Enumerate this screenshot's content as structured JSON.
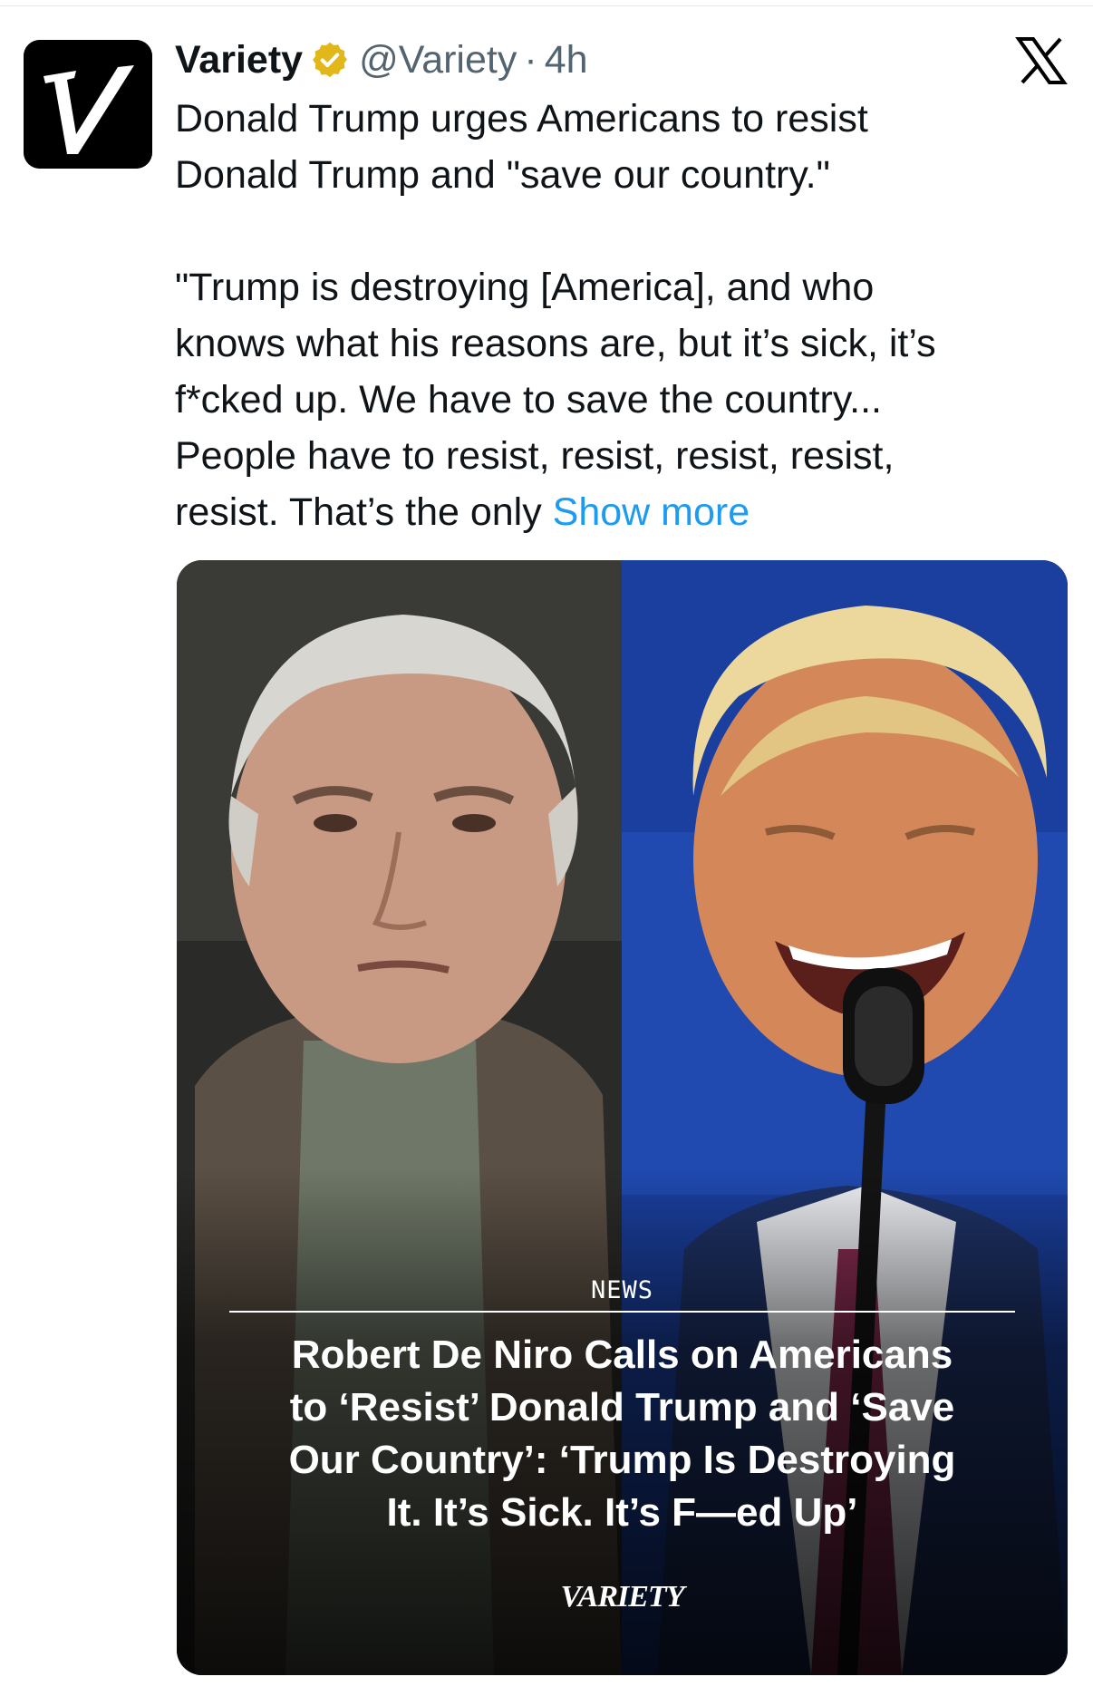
{
  "tweet": {
    "author": {
      "name": "Variety",
      "handle": "@Variety",
      "separator": "·",
      "time": "4h",
      "verified_color": "#e2b719",
      "avatar_icon": "variety-v-logo-icon"
    },
    "platform_icon": "x-logo-icon",
    "lines": {
      "line1": "Donald Trump urges Americans to resist",
      "line2": "Donald Trump and \"save our country.\"",
      "line3": "\"Trump is destroying [America], and who",
      "line4": "knows what his reasons are, but it’s sick, it’s",
      "line5": "f*cked up. We have to save the country...",
      "line6": "People have to resist, resist, resist, resist,",
      "line7": "resist. That’s the only "
    },
    "show_more": "Show more",
    "link_color": "#1d9bf0",
    "media": {
      "category": "NEWS",
      "headline": {
        "l1": "Robert De Niro Calls on Americans",
        "l2": "to ‘Resist’ Donald Trump and ‘Save",
        "l3": "Our Country’: ‘Trump Is Destroying",
        "l4": "It. It’s Sick. It’s F—ed Up’"
      },
      "wordmark": "VARIETY"
    }
  }
}
